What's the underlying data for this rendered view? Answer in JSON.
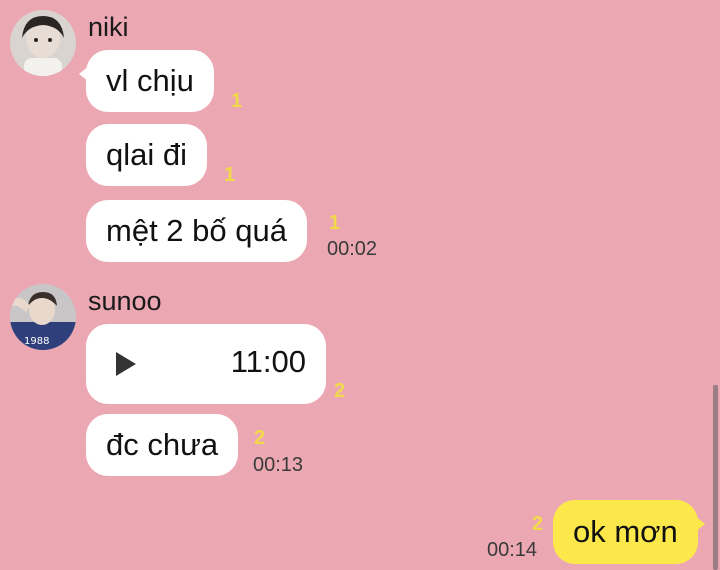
{
  "chat": {
    "messages_group_1": {
      "sender": "niki",
      "avatar_icon": "user-avatar-niki",
      "messages": [
        {
          "text": "vl chịu",
          "unread": "1"
        },
        {
          "text": "qlai đi",
          "unread": "1"
        },
        {
          "text": "mệt 2 bố quá",
          "unread": "1",
          "time": "00:02"
        }
      ]
    },
    "messages_group_2": {
      "sender": "sunoo",
      "avatar_icon": "user-avatar-sunoo",
      "voice": {
        "icon": "play-icon",
        "duration": "11:00",
        "unread": "2"
      },
      "messages": [
        {
          "text": "đc chưa",
          "unread": "2",
          "time": "00:13"
        }
      ]
    },
    "my_message": {
      "text": "ok mơn",
      "unread": "2",
      "time": "00:14"
    }
  },
  "colors": {
    "background": "#eba8b3",
    "incoming_bubble": "#ffffff",
    "outgoing_bubble": "#fce84a",
    "unread_count": "#f2d94a"
  }
}
